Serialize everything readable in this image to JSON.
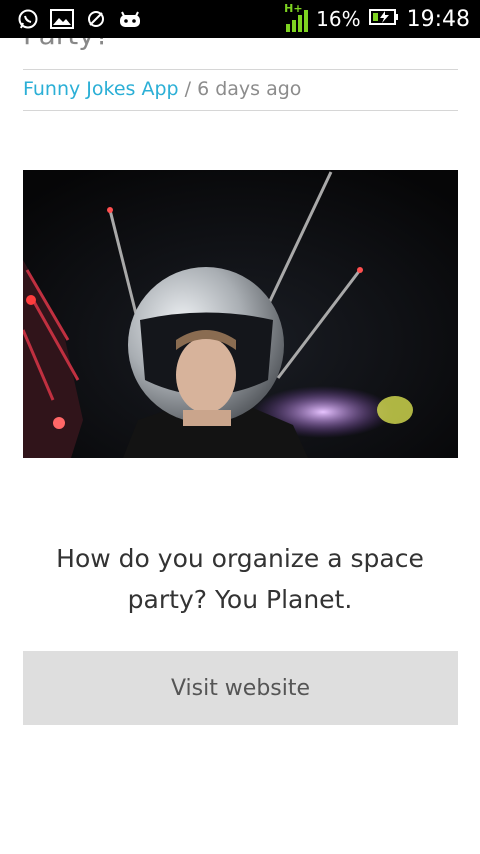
{
  "status_bar": {
    "icons": [
      "whatsapp-icon",
      "gallery-icon",
      "no-sync-icon",
      "android-icon"
    ],
    "network": "H+",
    "battery_percent": "16%",
    "time": "19:48"
  },
  "article": {
    "title_fragment": "Party?",
    "source_link": "Funny Jokes App",
    "separator": " / ",
    "posted": "6 days ago",
    "joke_text": "How do you organize a space party? You Planet.",
    "visit_button": "Visit website"
  },
  "colors": {
    "link": "#2bafd6",
    "button_bg": "#dedede",
    "status_bar_bg": "#000000"
  }
}
